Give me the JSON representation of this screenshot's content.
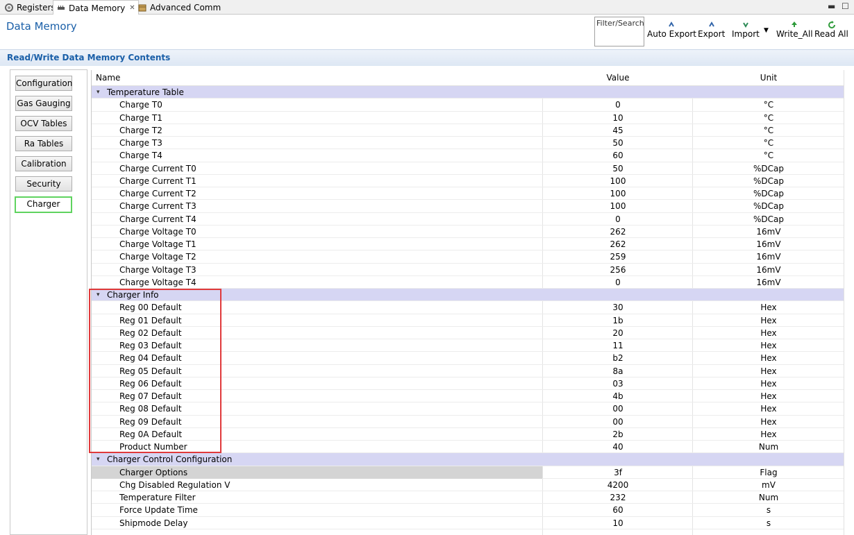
{
  "tabs": [
    {
      "label": "Registers",
      "icon": "gear-icon"
    },
    {
      "label": "Data Memory",
      "icon": "chip-icon"
    },
    {
      "label": "Advanced Comm",
      "icon": "package-icon"
    }
  ],
  "header": {
    "title": "Data Memory",
    "filter_label": "Filter/Search",
    "tools": [
      {
        "label": "Auto Export",
        "icon": "auto-export-icon"
      },
      {
        "label": "Export",
        "icon": "export-icon"
      },
      {
        "label": "Import",
        "icon": "import-icon"
      },
      {
        "label": "Write_All",
        "icon": "write-all-icon"
      },
      {
        "label": "Read All",
        "icon": "read-all-icon"
      }
    ]
  },
  "section": {
    "title": "Read/Write Data Memory Contents"
  },
  "categories": [
    "Configuration",
    "Gas Gauging",
    "OCV Tables",
    "Ra Tables",
    "Calibration",
    "Security",
    "Charger"
  ],
  "active_category": "Charger",
  "table": {
    "columns": {
      "name": "Name",
      "value": "Value",
      "unit": "Unit"
    },
    "rows": [
      {
        "type": "group",
        "name": "Temperature Table"
      },
      {
        "name": "Charge T0",
        "value": "0",
        "unit": "°C"
      },
      {
        "name": "Charge T1",
        "value": "10",
        "unit": "°C"
      },
      {
        "name": "Charge T2",
        "value": "45",
        "unit": "°C"
      },
      {
        "name": "Charge T3",
        "value": "50",
        "unit": "°C"
      },
      {
        "name": "Charge T4",
        "value": "60",
        "unit": "°C"
      },
      {
        "name": "Charge Current T0",
        "value": "50",
        "unit": "%DCap"
      },
      {
        "name": "Charge Current T1",
        "value": "100",
        "unit": "%DCap"
      },
      {
        "name": "Charge Current T2",
        "value": "100",
        "unit": "%DCap"
      },
      {
        "name": "Charge Current T3",
        "value": "100",
        "unit": "%DCap"
      },
      {
        "name": "Charge Current T4",
        "value": "0",
        "unit": "%DCap"
      },
      {
        "name": "Charge Voltage T0",
        "value": "262",
        "unit": "16mV"
      },
      {
        "name": "Charge Voltage T1",
        "value": "262",
        "unit": "16mV"
      },
      {
        "name": "Charge Voltage T2",
        "value": "259",
        "unit": "16mV"
      },
      {
        "name": "Charge Voltage T3",
        "value": "256",
        "unit": "16mV"
      },
      {
        "name": "Charge Voltage T4",
        "value": "0",
        "unit": "16mV"
      },
      {
        "type": "group",
        "name": "Charger Info"
      },
      {
        "name": "Reg 00 Default",
        "value": "30",
        "unit": "Hex"
      },
      {
        "name": "Reg 01 Default",
        "value": "1b",
        "unit": "Hex"
      },
      {
        "name": "Reg 02 Default",
        "value": "20",
        "unit": "Hex"
      },
      {
        "name": "Reg 03 Default",
        "value": "11",
        "unit": "Hex"
      },
      {
        "name": "Reg 04 Default",
        "value": "b2",
        "unit": "Hex"
      },
      {
        "name": "Reg 05 Default",
        "value": "8a",
        "unit": "Hex"
      },
      {
        "name": "Reg 06 Default",
        "value": "03",
        "unit": "Hex"
      },
      {
        "name": "Reg 07 Default",
        "value": "4b",
        "unit": "Hex"
      },
      {
        "name": "Reg 08 Default",
        "value": "00",
        "unit": "Hex"
      },
      {
        "name": "Reg 09 Default",
        "value": "00",
        "unit": "Hex"
      },
      {
        "name": "Reg 0A Default",
        "value": "2b",
        "unit": "Hex"
      },
      {
        "name": "Product Number",
        "value": "40",
        "unit": "Num"
      },
      {
        "type": "group",
        "name": "Charger Control Configuration"
      },
      {
        "name": "Charger Options",
        "value": "3f",
        "unit": "Flag",
        "selected": true
      },
      {
        "name": "Chg Disabled Regulation V",
        "value": "4200",
        "unit": "mV"
      },
      {
        "name": "Temperature Filter",
        "value": "232",
        "unit": "Num"
      },
      {
        "name": "Force Update Time",
        "value": "60",
        "unit": "s"
      },
      {
        "name": "Shipmode Delay",
        "value": "10",
        "unit": "s"
      }
    ]
  },
  "colors": {
    "title_blue": "#1a5fa8",
    "group_row": "#d6d6f3",
    "highlight_red": "#e0393b",
    "active_green": "#5fd35f"
  }
}
